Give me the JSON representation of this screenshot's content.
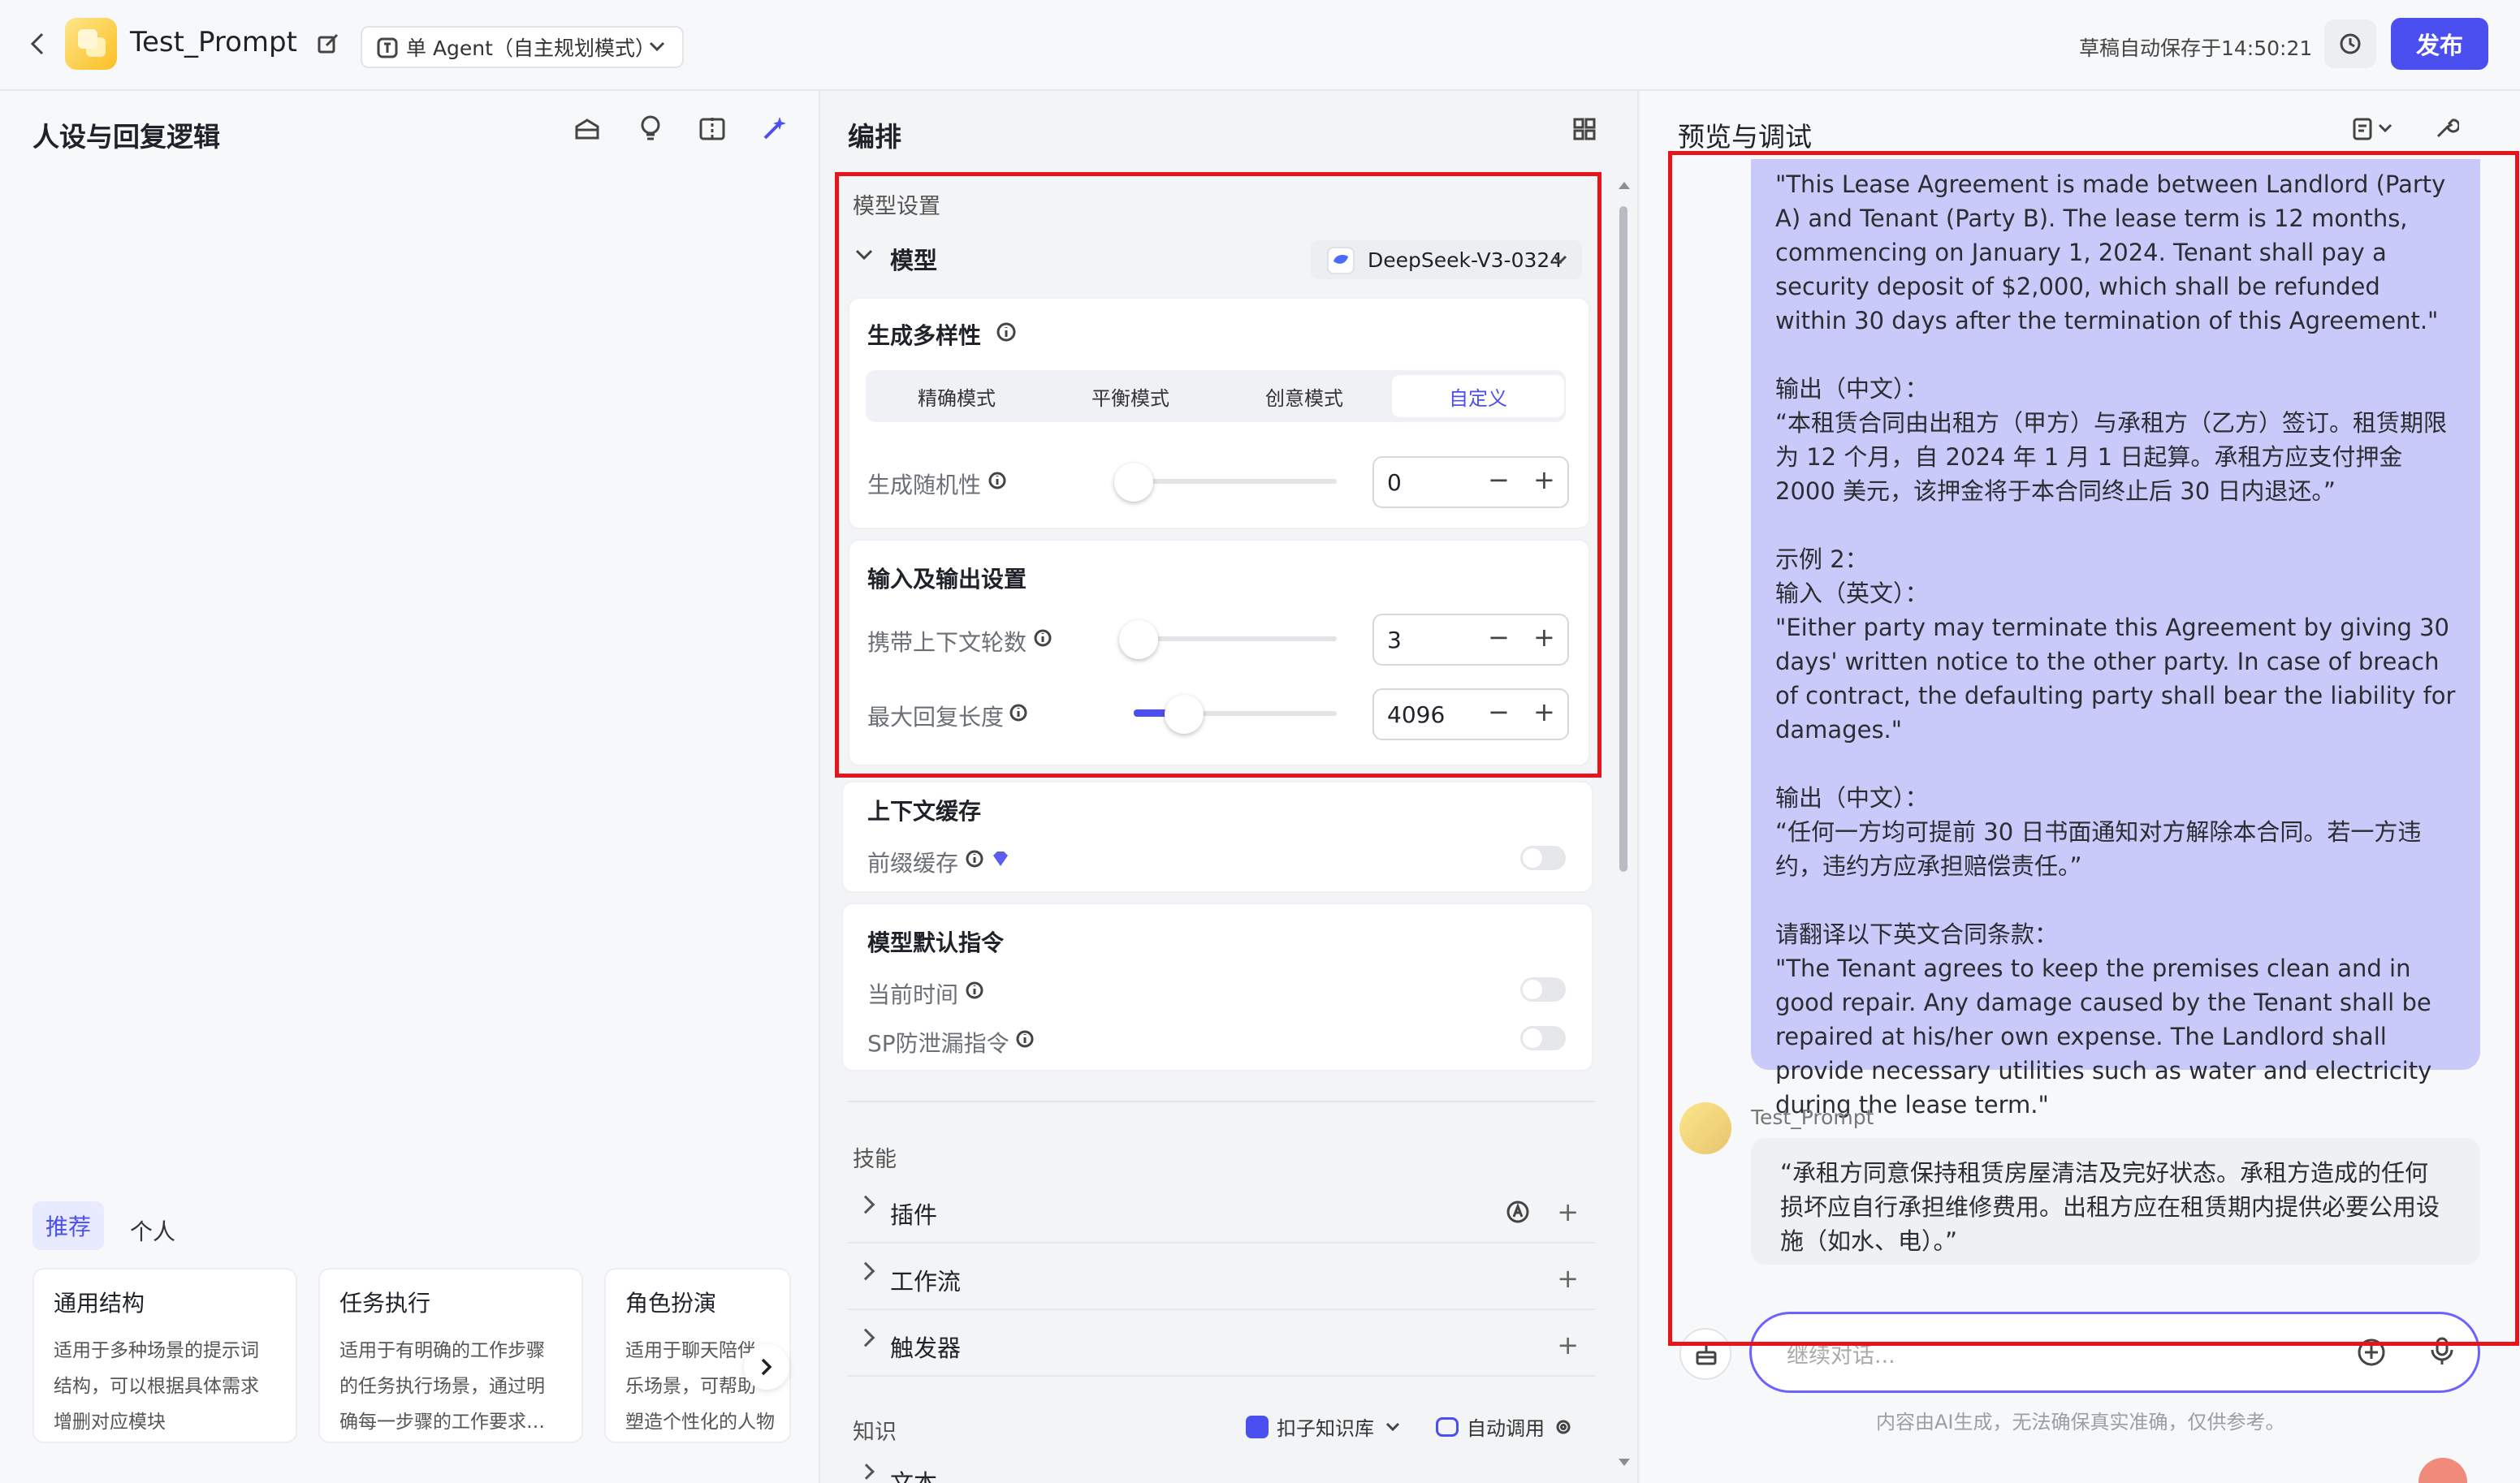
{
  "header": {
    "app_title": "Test_Prompt",
    "mode_selector": "单 Agent（自主规划模式）",
    "draft_status": "草稿自动保存于14:50:21",
    "publish_label": "发布"
  },
  "left_panel": {
    "title": "人设与回复逻辑",
    "tabs": [
      "推荐",
      "个人"
    ],
    "cards": [
      {
        "title": "通用结构",
        "desc": [
          "适用于多种场景的提示词",
          "结构，可以根据具体需求",
          "增删对应模块"
        ]
      },
      {
        "title": "任务执行",
        "desc": [
          "适用于有明确的工作步骤",
          "的任务执行场景，通过明",
          "确每一步骤的工作要求…"
        ]
      },
      {
        "title": "角色扮演",
        "desc": [
          "适用于聊天陪伴",
          "乐场景，可帮助",
          "塑造个性化的人物"
        ]
      }
    ]
  },
  "middle_panel": {
    "title": "编排",
    "model_settings_label": "模型设置",
    "model_label": "模型",
    "model_value": "DeepSeek-V3-0324",
    "diversity": {
      "title": "生成多样性",
      "modes": [
        "精确模式",
        "平衡模式",
        "创意模式",
        "自定义"
      ],
      "active_mode": "自定义",
      "randomness_label": "生成随机性",
      "randomness_value": "0",
      "randomness_fraction": 0.0
    },
    "io": {
      "title": "输入及输出设置",
      "context_rounds_label": "携带上下文轮数",
      "context_rounds_value": "3",
      "context_rounds_fraction": 0.03,
      "max_reply_label": "最大回复长度",
      "max_reply_value": "4096",
      "max_reply_fraction": 0.25
    },
    "cache": {
      "title": "上下文缓存",
      "prefix_label": "前缀缓存"
    },
    "default_instructions": {
      "title": "模型默认指令",
      "current_time_label": "当前时间",
      "sp_leak_label": "SP防泄漏指令"
    },
    "skills": {
      "title": "技能",
      "items": [
        "插件",
        "工作流",
        "触发器"
      ]
    },
    "knowledge": {
      "title": "知识",
      "kb_label": "扣子知识库",
      "auto_call_label": "自动调用",
      "next_item": "文本"
    }
  },
  "right_panel": {
    "title": "预览与调试",
    "user_message": "\"This Lease Agreement is made between Landlord (Party A) and Tenant (Party B). The lease term is 12 months, commencing on January 1, 2024. Tenant shall pay a security deposit of $2,000, which shall be refunded within 30 days after the termination of this Agreement.\"\n\n输出（中文）：\n“本租赁合同由出租方（甲方）与承租方（乙方）签订。租赁期限为 12 个月，自 2024 年 1 月 1 日起算。承租方应支付押金 2000 美元，该押金将于本合同终止后 30 日内退还。”\n\n示例 2：\n输入（英文）：\n\"Either party may terminate this Agreement by giving 30 days' written notice to the other party. In case of breach of contract, the defaulting party shall bear the liability for damages.\"\n\n输出（中文）：\n“任何一方均可提前 30 日书面通知对方解除本合同。若一方违约，违约方应承担赔偿责任。”\n\n请翻译以下英文合同条款：\n\"The Tenant agrees to keep the premises clean and in good repair. Any damage caused by the Tenant shall be repaired at his/her own expense. The Landlord shall provide necessary utilities such as water and electricity during the lease term.\"",
    "bot_name": "Test_Prompt",
    "bot_message": "“承租方同意保持租赁房屋清洁及完好状态。承租方造成的任何损坏应自行承担维修费用。出租方应在租赁期内提供必要公用设施（如水、电）。”",
    "input_placeholder": "继续对话...",
    "disclaimer": "内容由AI生成，无法确保真实准确，仅供参考。"
  },
  "colors": {
    "accent": "#4c4ff0",
    "highlight_box": "#e8141b",
    "user_bubble": "#c9caf9"
  }
}
